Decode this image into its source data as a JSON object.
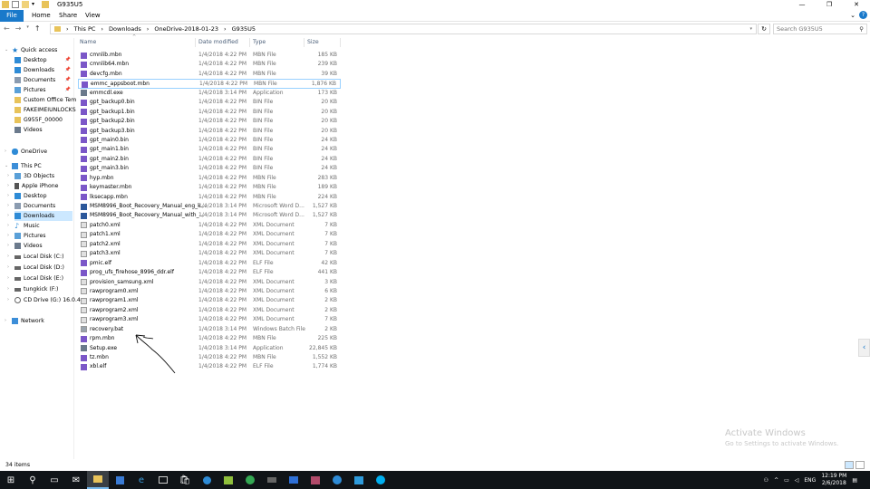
{
  "window": {
    "title": "G935U5"
  },
  "ribbon": {
    "file": "File",
    "home": "Home",
    "share": "Share",
    "view": "View"
  },
  "address": {
    "parts": [
      "This PC",
      "Downloads",
      "OneDrive-2018-01-23",
      "G935U5"
    ],
    "search_placeholder": "Search G935U5"
  },
  "columns": {
    "name": "Name",
    "date": "Date modified",
    "type": "Type",
    "size": "Size"
  },
  "nav": {
    "quick_access": "Quick access",
    "items": [
      "Desktop",
      "Downloads",
      "Documents",
      "Pictures",
      "Custom Office Tem",
      "FAKEIMEIUNLOCKS",
      "G955F_00000",
      "Videos"
    ],
    "onedrive": "OneDrive",
    "this_pc": "This PC",
    "pc_items": [
      "3D Objects",
      "Apple iPhone",
      "Desktop",
      "Documents",
      "Downloads",
      "Music",
      "Pictures",
      "Videos",
      "Local Disk (C:)",
      "Local Disk (D:)",
      "Local Disk (E:)",
      "tungkick (F:)",
      "CD Drive (G:) 16.0.4"
    ],
    "network": "Network"
  },
  "files": [
    {
      "name": "cmnlib.mbn",
      "date": "1/4/2018 4:22 PM",
      "type": "MBN File",
      "size": "185 KB",
      "icon": "mbn"
    },
    {
      "name": "cmnlib64.mbn",
      "date": "1/4/2018 4:22 PM",
      "type": "MBN File",
      "size": "239 KB",
      "icon": "mbn"
    },
    {
      "name": "devcfg.mbn",
      "date": "1/4/2018 4:22 PM",
      "type": "MBN File",
      "size": "39 KB",
      "icon": "mbn"
    },
    {
      "name": "emmc_appsboot.mbn",
      "date": "1/4/2018 4:22 PM",
      "type": "MBN File",
      "size": "1,876 KB",
      "icon": "mbn"
    },
    {
      "name": "emmcdl.exe",
      "date": "1/4/2018 3:14 PM",
      "type": "Application",
      "size": "173 KB",
      "icon": "exe"
    },
    {
      "name": "gpt_backup0.bin",
      "date": "1/4/2018 4:22 PM",
      "type": "BIN File",
      "size": "20 KB",
      "icon": "mbn"
    },
    {
      "name": "gpt_backup1.bin",
      "date": "1/4/2018 4:22 PM",
      "type": "BIN File",
      "size": "20 KB",
      "icon": "mbn"
    },
    {
      "name": "gpt_backup2.bin",
      "date": "1/4/2018 4:22 PM",
      "type": "BIN File",
      "size": "20 KB",
      "icon": "mbn"
    },
    {
      "name": "gpt_backup3.bin",
      "date": "1/4/2018 4:22 PM",
      "type": "BIN File",
      "size": "20 KB",
      "icon": "mbn"
    },
    {
      "name": "gpt_main0.bin",
      "date": "1/4/2018 4:22 PM",
      "type": "BIN File",
      "size": "24 KB",
      "icon": "mbn"
    },
    {
      "name": "gpt_main1.bin",
      "date": "1/4/2018 4:22 PM",
      "type": "BIN File",
      "size": "24 KB",
      "icon": "mbn"
    },
    {
      "name": "gpt_main2.bin",
      "date": "1/4/2018 4:22 PM",
      "type": "BIN File",
      "size": "24 KB",
      "icon": "mbn"
    },
    {
      "name": "gpt_main3.bin",
      "date": "1/4/2018 4:22 PM",
      "type": "BIN File",
      "size": "24 KB",
      "icon": "mbn"
    },
    {
      "name": "hyp.mbn",
      "date": "1/4/2018 4:22 PM",
      "type": "MBN File",
      "size": "283 KB",
      "icon": "mbn"
    },
    {
      "name": "keymaster.mbn",
      "date": "1/4/2018 4:22 PM",
      "type": "MBN File",
      "size": "189 KB",
      "icon": "mbn"
    },
    {
      "name": "lksecapp.mbn",
      "date": "1/4/2018 4:22 PM",
      "type": "MBN File",
      "size": "224 KB",
      "icon": "mbn"
    },
    {
      "name": "MSM8996_Boot_Recovery_Manual_eng_k...",
      "date": "1/4/2018 3:14 PM",
      "type": "Microsoft Word D...",
      "size": "1,527 KB",
      "icon": "doc"
    },
    {
      "name": "MSM8996_Boot_Recovery_Manual_with_...",
      "date": "1/4/2018 3:14 PM",
      "type": "Microsoft Word D...",
      "size": "1,527 KB",
      "icon": "doc"
    },
    {
      "name": "patch0.xml",
      "date": "1/4/2018 4:22 PM",
      "type": "XML Document",
      "size": "7 KB",
      "icon": "xml"
    },
    {
      "name": "patch1.xml",
      "date": "1/4/2018 4:22 PM",
      "type": "XML Document",
      "size": "7 KB",
      "icon": "xml"
    },
    {
      "name": "patch2.xml",
      "date": "1/4/2018 4:22 PM",
      "type": "XML Document",
      "size": "7 KB",
      "icon": "xml"
    },
    {
      "name": "patch3.xml",
      "date": "1/4/2018 4:22 PM",
      "type": "XML Document",
      "size": "7 KB",
      "icon": "xml"
    },
    {
      "name": "pmic.elf",
      "date": "1/4/2018 4:22 PM",
      "type": "ELF File",
      "size": "42 KB",
      "icon": "mbn"
    },
    {
      "name": "prog_ufs_firehose_8996_ddr.elf",
      "date": "1/4/2018 4:22 PM",
      "type": "ELF File",
      "size": "441 KB",
      "icon": "mbn"
    },
    {
      "name": "provision_samsung.xml",
      "date": "1/4/2018 4:22 PM",
      "type": "XML Document",
      "size": "3 KB",
      "icon": "xml"
    },
    {
      "name": "rawprogram0.xml",
      "date": "1/4/2018 4:22 PM",
      "type": "XML Document",
      "size": "6 KB",
      "icon": "xml"
    },
    {
      "name": "rawprogram1.xml",
      "date": "1/4/2018 4:22 PM",
      "type": "XML Document",
      "size": "2 KB",
      "icon": "xml"
    },
    {
      "name": "rawprogram2.xml",
      "date": "1/4/2018 4:22 PM",
      "type": "XML Document",
      "size": "2 KB",
      "icon": "xml"
    },
    {
      "name": "rawprogram3.xml",
      "date": "1/4/2018 4:22 PM",
      "type": "XML Document",
      "size": "7 KB",
      "icon": "xml"
    },
    {
      "name": "recovery.bat",
      "date": "1/4/2018 3:14 PM",
      "type": "Windows Batch File",
      "size": "2 KB",
      "icon": "bat"
    },
    {
      "name": "rpm.mbn",
      "date": "1/4/2018 4:22 PM",
      "type": "MBN File",
      "size": "225 KB",
      "icon": "mbn"
    },
    {
      "name": "Setup.exe",
      "date": "1/4/2018 3:14 PM",
      "type": "Application",
      "size": "22,845 KB",
      "icon": "exe"
    },
    {
      "name": "tz.mbn",
      "date": "1/4/2018 4:22 PM",
      "type": "MBN File",
      "size": "1,552 KB",
      "icon": "mbn"
    },
    {
      "name": "xbl.elf",
      "date": "1/4/2018 4:22 PM",
      "type": "ELF File",
      "size": "1,774 KB",
      "icon": "mbn"
    }
  ],
  "status": {
    "count": "34 items"
  },
  "watermark": {
    "title": "Activate Windows",
    "subtitle": "Go to Settings to activate Windows."
  },
  "tray": {
    "lang": "ENG",
    "time": "12:19 PM",
    "date": "2/6/2018"
  },
  "colors": {
    "accent": "#1979ca",
    "selection": "#cce8ff",
    "mbn_icon": "#7b57c8"
  }
}
